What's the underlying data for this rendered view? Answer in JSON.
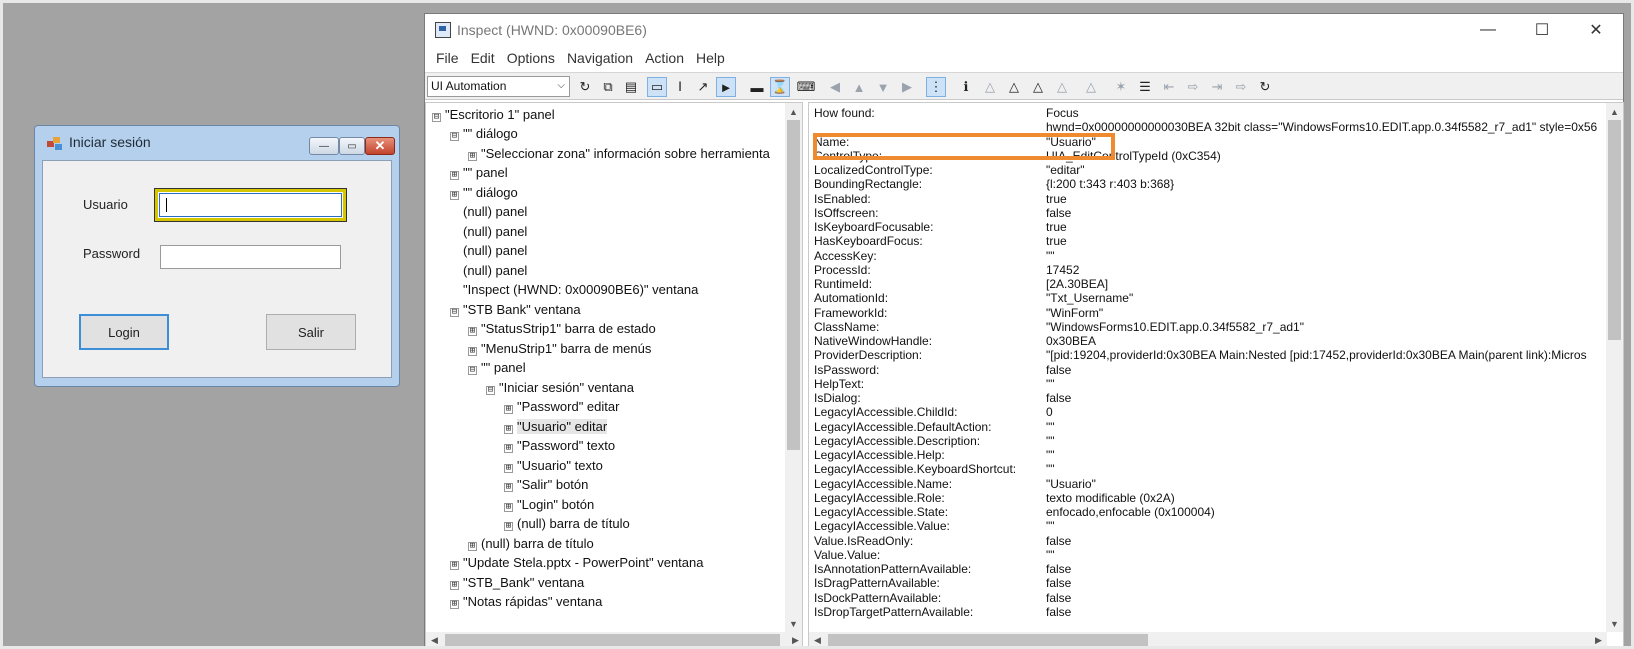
{
  "login_window": {
    "title": "Iniciar sesión",
    "caption_buttons": {
      "minimize": "—",
      "maximize": "▭",
      "close": "✕"
    },
    "usuario_label": "Usuario",
    "usuario_value": "",
    "password_label": "Password",
    "password_value": "",
    "login_button": "Login",
    "salir_button": "Salir",
    "icon_colors": [
      "#c04a3a",
      "#e6a23c",
      "#4a90d9"
    ]
  },
  "inspect_window": {
    "title": "Inspect  (HWND: 0x00090BE6)",
    "window_controls": {
      "minimize": "—",
      "maximize": "☐",
      "close": "✕"
    },
    "menu": [
      "File",
      "Edit",
      "Options",
      "Navigation",
      "Action",
      "Help"
    ],
    "mode_combo": "UI Automation",
    "tree": [
      {
        "exp": "⊟",
        "label": "\"Escritorio 1\" panel"
      },
      {
        "exp": "⊟",
        "label": "\"\" diálogo"
      },
      {
        "exp": "⊞",
        "label": "\"Seleccionar zona\" información sobre herramienta"
      },
      {
        "exp": "⊞",
        "label": "\"\" panel"
      },
      {
        "exp": "⊞",
        "label": "\"\" diálogo"
      },
      {
        "exp": "",
        "label": "(null) panel"
      },
      {
        "exp": "",
        "label": "(null) panel"
      },
      {
        "exp": "",
        "label": "(null) panel"
      },
      {
        "exp": "",
        "label": "(null) panel"
      },
      {
        "exp": "",
        "label": "\"Inspect  (HWND: 0x00090BE6)\" ventana"
      },
      {
        "exp": "⊟",
        "label": "\"STB Bank\" ventana"
      },
      {
        "exp": "⊞",
        "label": "\"StatusStrip1\" barra de estado"
      },
      {
        "exp": "⊞",
        "label": "\"MenuStrip1\" barra de menús"
      },
      {
        "exp": "⊟",
        "label": "\"\" panel"
      },
      {
        "exp": "⊟",
        "label": "\"Iniciar sesión\" ventana"
      },
      {
        "exp": "⊞",
        "label": "\"Password\" editar"
      },
      {
        "exp": "⊞",
        "label": "\"Usuario\" editar"
      },
      {
        "exp": "⊞",
        "label": "\"Password\" texto"
      },
      {
        "exp": "⊞",
        "label": "\"Usuario\" texto"
      },
      {
        "exp": "⊞",
        "label": "\"Salir\" botón"
      },
      {
        "exp": "⊞",
        "label": "\"Login\" botón"
      },
      {
        "exp": "⊞",
        "label": "(null) barra de título"
      },
      {
        "exp": "⊞",
        "label": "(null) barra de título"
      },
      {
        "exp": "⊞",
        "label": "\"Update Stela.pptx - PowerPoint\" ventana"
      },
      {
        "exp": "⊞",
        "label": "\"STB_Bank\" ventana"
      },
      {
        "exp": "⊞",
        "label": "\"Notas rápidas\" ventana"
      }
    ],
    "properties": [
      {
        "k": "How found:",
        "v": "Focus"
      },
      {
        "k": "",
        "v": "hwnd=0x00000000000030BEA 32bit class=\"WindowsForms10.EDIT.app.0.34f5582_r7_ad1\" style=0x56"
      },
      {
        "k": "Name:",
        "v": "\"Usuario\""
      },
      {
        "k": "ControlType:",
        "v": "UIA_EditControlTypeId (0xC354)"
      },
      {
        "k": "LocalizedControlType:",
        "v": "\"editar\""
      },
      {
        "k": "BoundingRectangle:",
        "v": "{l:200 t:343 r:403 b:368}"
      },
      {
        "k": "IsEnabled:",
        "v": "true"
      },
      {
        "k": "IsOffscreen:",
        "v": "false"
      },
      {
        "k": "IsKeyboardFocusable:",
        "v": "true"
      },
      {
        "k": "HasKeyboardFocus:",
        "v": "true"
      },
      {
        "k": "AccessKey:",
        "v": "\"\""
      },
      {
        "k": "ProcessId:",
        "v": "17452"
      },
      {
        "k": "RuntimeId:",
        "v": "[2A.30BEA]"
      },
      {
        "k": "AutomationId:",
        "v": "\"Txt_Username\""
      },
      {
        "k": "FrameworkId:",
        "v": "\"WinForm\""
      },
      {
        "k": "ClassName:",
        "v": "\"WindowsForms10.EDIT.app.0.34f5582_r7_ad1\""
      },
      {
        "k": "NativeWindowHandle:",
        "v": "0x30BEA"
      },
      {
        "k": "ProviderDescription:",
        "v": "\"[pid:19204,providerId:0x30BEA Main:Nested [pid:17452,providerId:0x30BEA Main(parent link):Micros"
      },
      {
        "k": "IsPassword:",
        "v": "false"
      },
      {
        "k": "HelpText:",
        "v": "\"\""
      },
      {
        "k": "IsDialog:",
        "v": "false"
      },
      {
        "k": "LegacyIAccessible.ChildId:",
        "v": "0"
      },
      {
        "k": "LegacyIAccessible.DefaultAction:",
        "v": "\"\""
      },
      {
        "k": "LegacyIAccessible.Description:",
        "v": "\"\""
      },
      {
        "k": "LegacyIAccessible.Help:",
        "v": "\"\""
      },
      {
        "k": "LegacyIAccessible.KeyboardShortcut:",
        "v": "\"\""
      },
      {
        "k": "LegacyIAccessible.Name:",
        "v": "\"Usuario\""
      },
      {
        "k": "LegacyIAccessible.Role:",
        "v": "texto modificable (0x2A)"
      },
      {
        "k": "LegacyIAccessible.State:",
        "v": "enfocado,enfocable (0x100004)"
      },
      {
        "k": "LegacyIAccessible.Value:",
        "v": "\"\""
      },
      {
        "k": "Value.IsReadOnly:",
        "v": "false"
      },
      {
        "k": "Value.Value:",
        "v": "\"\""
      },
      {
        "k": "IsAnnotationPatternAvailable:",
        "v": "false"
      },
      {
        "k": "IsDragPatternAvailable:",
        "v": "false"
      },
      {
        "k": "IsDockPatternAvailable:",
        "v": "false"
      },
      {
        "k": "IsDropTargetPatternAvailable:",
        "v": "false"
      }
    ],
    "highlight_color": "#f08a2e"
  }
}
